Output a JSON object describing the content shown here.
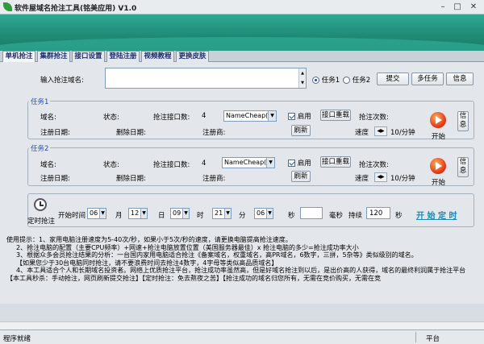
{
  "window": {
    "title": "软件屋域名抢注工具(铭美应用)  V1.0",
    "minimize": "–",
    "maximize": "□",
    "close": "✕"
  },
  "tabs": [
    "单机抢注",
    "集群抢注",
    "接口设置",
    "登陆注册",
    "视频教程",
    "更换皮肤"
  ],
  "top": {
    "domain_label": "输入抢注域名:",
    "task1_label": "任务1",
    "task2_label": "任务2",
    "selected_task": "任务1",
    "submit": "提交",
    "multi_task": "多任务",
    "info": "信息"
  },
  "task1": {
    "title": "任务1",
    "domain_label": "域名:",
    "status_label": "状态:",
    "api_count_label": "抢注接口数:",
    "api_count": "4",
    "registrar": "NameCheap(前",
    "enable_label": "启用",
    "enabled": true,
    "reload_button": "接口重载",
    "attempts_label": "抢注次数:",
    "reg_date_label": "注册日期:",
    "del_date_label": "删除日期:",
    "registrar_label": "注册商:",
    "refresh": "刷新",
    "speed_label": "速度",
    "speed_value": "10/分钟",
    "start_label": "开始",
    "info": "信息"
  },
  "task2": {
    "title": "任务2",
    "domain_label": "域名:",
    "status_label": "状态:",
    "api_count_label": "抢注接口数:",
    "api_count": "4",
    "registrar": "NameCheap(前",
    "enable_label": "启用",
    "enabled": true,
    "reload_button": "接口重载",
    "attempts_label": "抢注次数:",
    "reg_date_label": "注册日期:",
    "del_date_label": "删除日期:",
    "registrar_label": "注册商:",
    "refresh": "刷新",
    "speed_label": "速度",
    "speed_value": "10/分钟",
    "start_label": "开始",
    "info": "信息"
  },
  "timer": {
    "label": "定时抢注",
    "start_time_label": "开始时间",
    "month": "06",
    "month_label": "月",
    "day": "12",
    "day_label": "日",
    "hour": "09",
    "hour_label": "时",
    "minute": "21",
    "minute_label": "分",
    "second": "06",
    "second_label": "秒",
    "ms_label": "毫秒",
    "duration_label": "持续",
    "duration": "120",
    "duration_unit": "秒",
    "start_timer": "开 始 定 时"
  },
  "hints": [
    "使用提示：1、家用电脑注册速度为5-40次/秒，如果小于5次/秒的速度，请更换电脑提高抢注速度。",
    "2、抢注电脑的配置（主要CPU频率）+网速+抢注电脑放置位置（美国服务器最佳）x 抢注电脑的多少=抢注成功率大小",
    "3、根据众多会员抢注结果的分析：一台国内家用电脑适合抢注《备案域名，权重域名，高PR域名，6数字，三拼，5杂等》类似级别的域名。",
    "【如果您少于30台电脑同时抢注，请不要浪费时间去抢注4数字，4字母等类似高品质域名】",
    "4、本工具适合个人和长期域名投资者。网络上优质抢注平台，抢注成功率虽然高，但是好域名抢注到以后，是出价高的人获得，域名的最终利润属于抢注平台",
    "【本工具秒杀：手动抢注，网页刷新提交抢注】【定时抢注：免去熬夜之苦】【抢注成功的域名归您所有，无需在竞价购买，无需在竞"
  ],
  "status": {
    "left": "程序就绪",
    "right": "平台"
  }
}
